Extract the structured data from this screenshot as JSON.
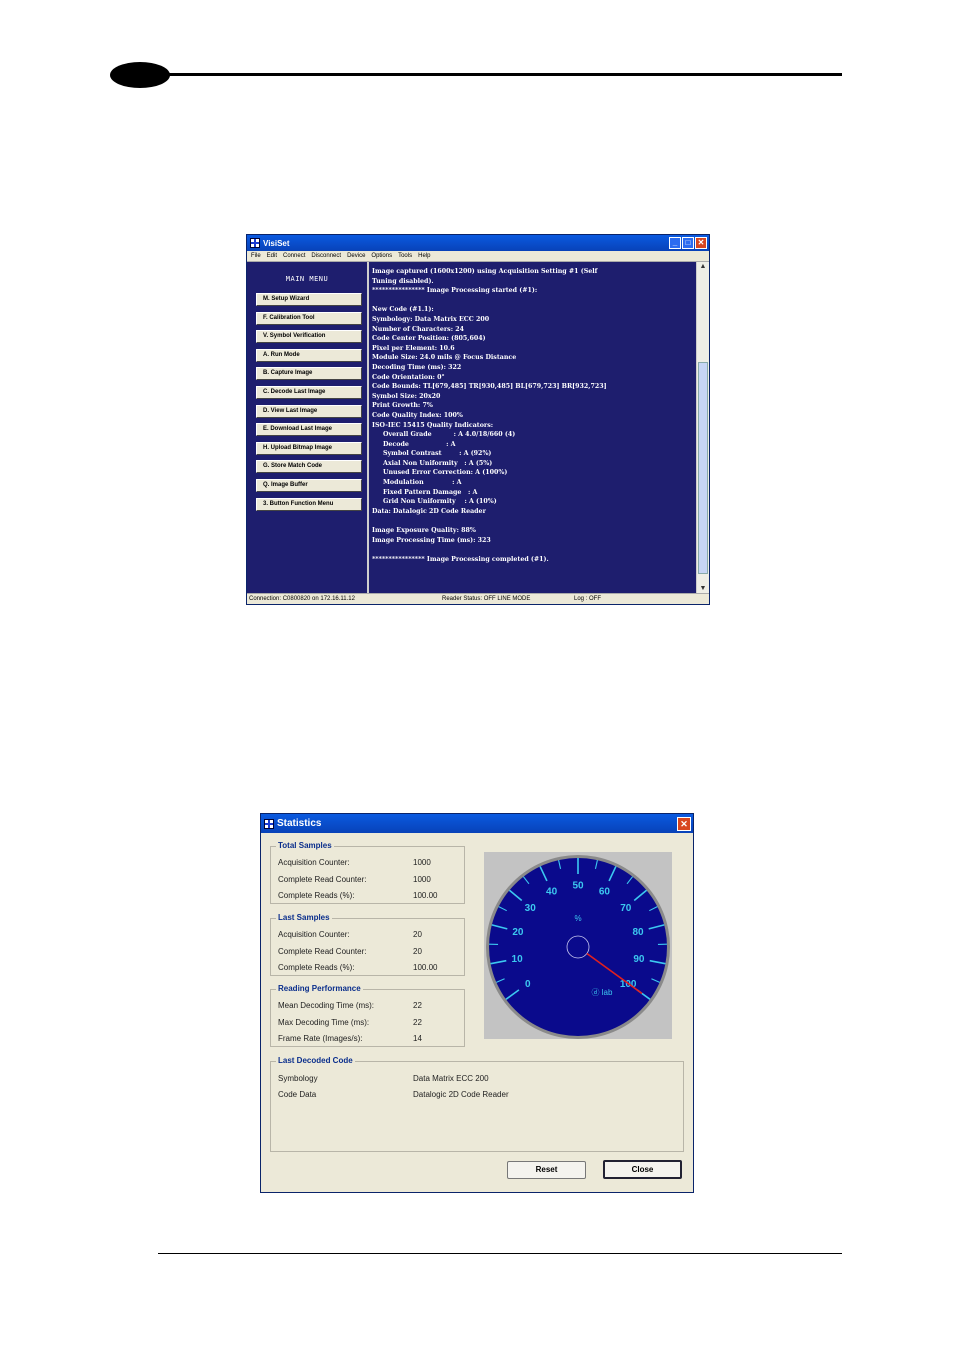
{
  "visiset": {
    "title": "VisiSet",
    "menu": [
      "File",
      "Edit",
      "Connect",
      "Disconnect",
      "Device",
      "Options",
      "Tools",
      "Help"
    ],
    "main_menu_title": "MAIN MENU",
    "buttons": [
      "M. Setup Wizard",
      "F. Calibration Tool",
      "V. Symbol Verification",
      "A. Run Mode",
      "B. Capture Image",
      "C. Decode Last Image",
      "D. View Last Image",
      "E. Download Last Image",
      "H. Upload Bitmap Image",
      "G. Store Match Code",
      "Q. Image Buffer",
      "3. Button Function Menu"
    ],
    "console_text": "Image captured (1600x1200) using Acquisition Setting #1 (Self\nTuning disabled).\n**************** Image Processing started (#1):\n\nNew Code (#1.1):\nSymbology: Data Matrix ECC 200\nNumber of Characters: 24\nCode Center Position: (805,604)\nPixel per Element: 10.6\nModule Size: 24.0 mils @ Focus Distance\nDecoding Time (ms): 322\nCode Orientation: 0°\nCode Bounds: TL[679,485] TR[930,485] BL[679,723] BR[932,723]\nSymbol Size: 20x20\nPrint Growth: 7%\nCode Quality Index: 100%\nISO-IEC 15415 Quality Indicators:\n     Overall Grade          : A 4.0/18/660 (4)\n     Decode                 : A\n     Symbol Contrast        : A (92%)\n     Axial Non Uniformity   : A (5%)\n     Unused Error Correction: A (100%)\n     Modulation             : A\n     Fixed Pattern Damage   : A\n     Grid Non Uniformity    : A (10%)\nData: Datalogic 2D Code Reader\n\nImage Exposure Quality: 88%\nImage Processing Time (ms): 323\n\n**************** Image Processing completed (#1).",
    "status": {
      "connection": "Connection: C0800820 on 172.16.11.12",
      "reader_status": "Reader Status: OFF LINE MODE",
      "log": "Log : OFF"
    }
  },
  "statistics": {
    "title": "Statistics",
    "total_samples": {
      "title": "Total Samples",
      "rows": [
        {
          "label": "Acquisition Counter:",
          "value": "1000"
        },
        {
          "label": "Complete Read Counter:",
          "value": "1000"
        },
        {
          "label": "Complete Reads (%):",
          "value": "100.00"
        }
      ]
    },
    "last_samples": {
      "title": "Last Samples",
      "rows": [
        {
          "label": "Acquisition Counter:",
          "value": "20"
        },
        {
          "label": "Complete Read Counter:",
          "value": "20"
        },
        {
          "label": "Complete Reads (%):",
          "value": "100.00"
        }
      ]
    },
    "reading_performance": {
      "title": "Reading Performance",
      "rows": [
        {
          "label": "Mean Decoding Time (ms):",
          "value": "22"
        },
        {
          "label": "Max Decoding Time (ms):",
          "value": "22"
        },
        {
          "label": "Frame Rate (Images/s):",
          "value": "14"
        }
      ]
    },
    "last_decoded": {
      "title": "Last Decoded Code",
      "rows": [
        {
          "label": "Symbology",
          "value": "Data Matrix ECC 200"
        },
        {
          "label": "Code Data",
          "value": "Datalogic 2D Code Reader"
        }
      ]
    },
    "gauge": {
      "value": 100,
      "min": 0,
      "max": 100,
      "ticks": [
        "0",
        "10",
        "20",
        "30",
        "40",
        "50",
        "60",
        "70",
        "80",
        "90",
        "100"
      ],
      "unit": "%",
      "brand": "ⓓ lab",
      "face_color": "#0a0a8c",
      "tick_color": "#3cc8f0",
      "needle_color": "#e02020"
    },
    "reset_label": "Reset",
    "close_label": "Close"
  }
}
